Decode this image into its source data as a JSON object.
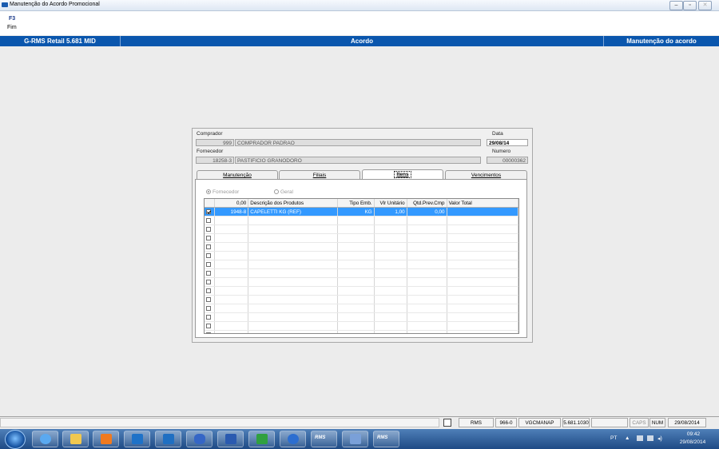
{
  "window": {
    "title": "Manutenção do Acordo Promocional"
  },
  "toolbar": {
    "key": "F3",
    "label": "Fim"
  },
  "header": {
    "left": "G-RMS Retail 5.681 MID",
    "center": "Acordo",
    "right": "Manutenção do acordo"
  },
  "form": {
    "comprador_label": "Comprador",
    "comprador_code": "999",
    "comprador_name": "COMPRADOR PADRAO",
    "data_label": "Data",
    "data_value": "29/08/14",
    "fornecedor_label": "Fornecedor",
    "fornecedor_code": "18258-3",
    "fornecedor_name": "PASTIFICIO GRANODORO",
    "numero_label": "Numero",
    "numero_value": "00000362"
  },
  "tabs": [
    {
      "label": "Manutenção"
    },
    {
      "label": "Filiais"
    },
    {
      "label": "Itens"
    },
    {
      "label": "Vencimentos"
    }
  ],
  "radios": {
    "fornecedor": "Fornecedor",
    "geral": "Geral"
  },
  "grid": {
    "columns": [
      "0,00",
      "Descrição dos Produtos",
      "Tipo Emb.",
      "Vlr Unitário",
      "Qtd.Prev.Cmp",
      "Valor Total"
    ],
    "rows": [
      {
        "checked": true,
        "code": "1948-8",
        "desc": "CAPELETTI KG (REF)",
        "emb": "KG",
        "vlr": "1,00",
        "qtd": "0,00",
        "total": ""
      }
    ],
    "empty_rows": 15
  },
  "statusbar": {
    "s1": "RMS",
    "s2": "966-0",
    "s3": "VGCMANAP",
    "s4": "5.681.1030",
    "s5": "",
    "caps": "CAPS",
    "num": "NUM",
    "date": "29/08/2014"
  },
  "taskbar": {
    "rms1": "RMS",
    "rms2": "RMS",
    "lang": "PT",
    "time": "09:42",
    "date": "29/08/2014"
  },
  "colors": {
    "band": "#0a56ad",
    "selection": "#3399ff"
  }
}
